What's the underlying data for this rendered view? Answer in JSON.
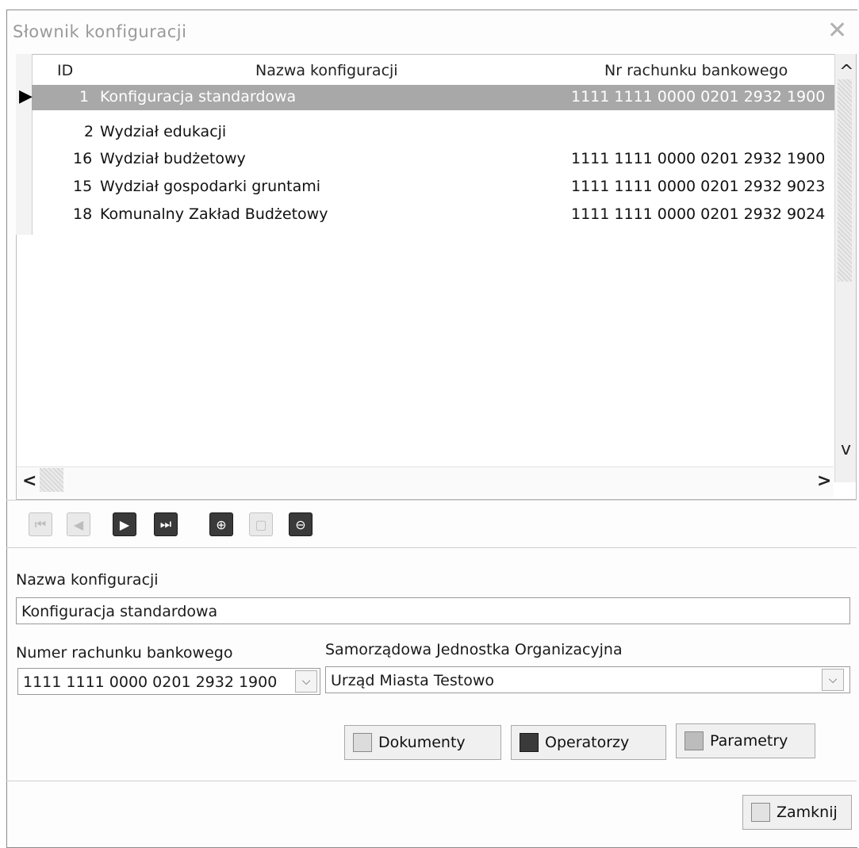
{
  "window": {
    "title": "Słownik konfiguracji",
    "close_glyph": "✕"
  },
  "grid": {
    "columns": [
      "ID",
      "Nazwa konfiguracji",
      "Nr rachunku bankowego"
    ],
    "rows": [
      {
        "id": "1",
        "name": "Konfiguracja standardowa",
        "account": "1111 1111 0000 0201 2932 1900",
        "selected": true
      },
      {
        "id": "2",
        "name": "Wydział edukacji",
        "account": ""
      },
      {
        "id": "16",
        "name": "Wydział budżetowy",
        "account": "1111 1111 0000 0201 2932 1900"
      },
      {
        "id": "15",
        "name": "Wydział gospodarki gruntami",
        "account": "1111 1111 0000 0201 2932 9023"
      },
      {
        "id": "18",
        "name": "Komunalny Zakład Budżetowy",
        "account": "1111 1111 0000 0201 2932 9024"
      }
    ],
    "row_pointer": "▶",
    "scroll_up": "^",
    "scroll_down": "v",
    "scroll_left": "<",
    "scroll_right": ">"
  },
  "navigator": {
    "icons": [
      "first-icon",
      "prior-icon",
      "next-icon",
      "last-icon",
      "insert-icon",
      "edit-icon",
      "delete-icon"
    ]
  },
  "form": {
    "name_label": "Nazwa konfiguracji",
    "name_value": "Konfiguracja standardowa",
    "account_label": "Numer rachunku bankowego",
    "account_value": "1111 1111 0000 0201 2932 1900",
    "unit_label": "Samorządowa Jednostka Organizacyjna",
    "unit_value": "Urząd Miasta Testowo",
    "dropdown_glyph": "⌵"
  },
  "actions": {
    "documents": "Dokumenty",
    "operators": "Operatorzy",
    "parameters": "Parametry",
    "close": "Zamknij"
  },
  "colors": {
    "selection": "#a8a8a8",
    "nav_dark": "#3a3a3a"
  }
}
